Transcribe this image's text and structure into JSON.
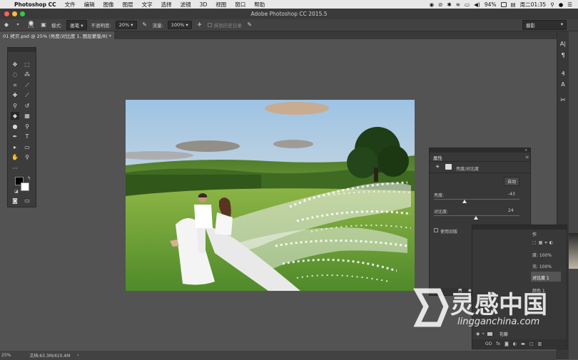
{
  "menubar": {
    "app": "Photoshop CC",
    "items": [
      "文件",
      "编辑",
      "图像",
      "图层",
      "文字",
      "选择",
      "滤镜",
      "3D",
      "视图",
      "窗口",
      "帮助"
    ],
    "battery": "94%",
    "clock": "周二01:35"
  },
  "window": {
    "title": "Adobe Photoshop CC 2015.5"
  },
  "options": {
    "brush_size": "175",
    "mode_label": "模式:",
    "mode_value": "画笔",
    "opacity_label": "不透明度:",
    "opacity_value": "20%",
    "flow_label": "流量:",
    "flow_value": "100%",
    "history_label": "抹到历史记录",
    "workspace": "摄影"
  },
  "document": {
    "tab_label": "01 拷贝.psd @ 25% (亮度/对比度 1, 图层蒙版/8) *"
  },
  "properties": {
    "title": "属性",
    "adjustment": "亮度/对比度",
    "auto_label": "自动",
    "brightness_label": "亮度:",
    "brightness_value": "-43",
    "brightness": -43,
    "contrast_label": "对比度:",
    "contrast_value": "24",
    "contrast": 24,
    "legacy_label": "使用旧版"
  },
  "layers": {
    "tab_fragment": "作",
    "opacity_fragment": "度: 100%",
    "fill_fragment": "充: 100%",
    "layer_selected": "对比度 1",
    "layer2": "颜色 1",
    "layer3": "2",
    "group_name": "花瓣",
    "footer": [
      "GO",
      "fx"
    ]
  },
  "status": {
    "zoom": "25%",
    "doc_info": "文档:63.3M/410.4M"
  },
  "watermark": {
    "brand": "灵感中国",
    "url": "lingganchina.com"
  },
  "colors": {
    "menubar_bg": "#e8e8e8",
    "ps_dark": "#383838",
    "workspace_bg": "#535353"
  },
  "icons": [
    "apple-icon",
    "eraser-icon",
    "airbrush-icon",
    "move-icon",
    "marquee-icon",
    "lasso-icon",
    "magic-wand-icon",
    "crop-icon",
    "eyedropper-icon",
    "healing-icon",
    "brush-icon",
    "stamp-icon",
    "history-brush-icon",
    "eraser-tool-icon",
    "gradient-icon",
    "dodge-icon",
    "pen-icon",
    "type-icon",
    "path-select-icon",
    "shape-icon",
    "hand-icon",
    "zoom-icon"
  ]
}
